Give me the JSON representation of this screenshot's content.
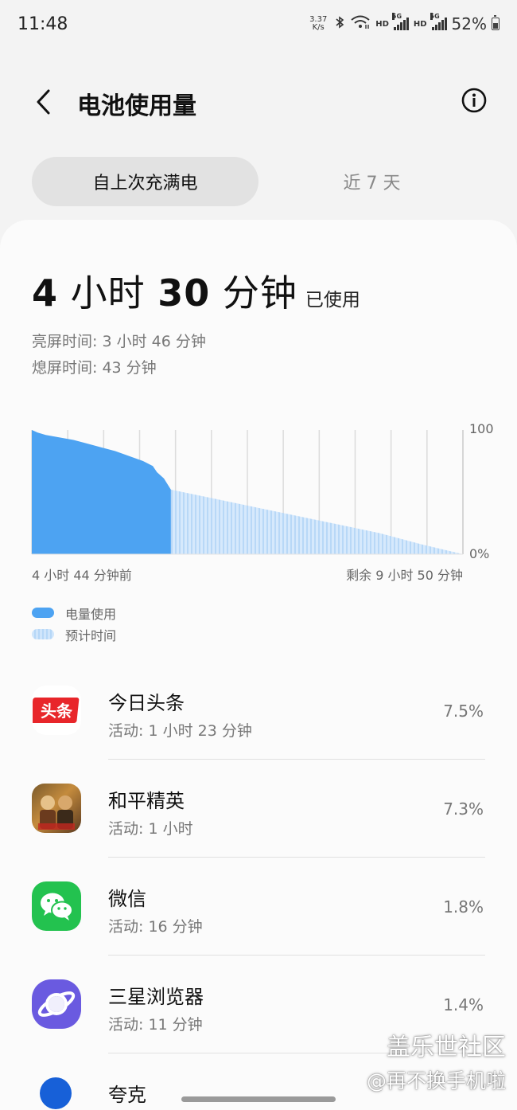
{
  "status_bar": {
    "time": "11:48",
    "net_speed_value": "3.37",
    "net_speed_unit": "K/s",
    "hd_1": "HD",
    "hd_2": "HD",
    "network_1": "5G",
    "network_2": "5G",
    "battery": "52%"
  },
  "header": {
    "title": "电池使用量"
  },
  "tabs": [
    {
      "label": "自上次充满电",
      "active": true
    },
    {
      "label": "近 7 天",
      "active": false
    }
  ],
  "summary": {
    "hours": "4",
    "hours_unit": "小时",
    "minutes": "30",
    "minutes_unit": "分钟",
    "suffix": "已使用",
    "screen_on": "亮屏时间: 3 小时 46 分钟",
    "screen_off": "熄屏时间: 43 分钟"
  },
  "chart_data": {
    "type": "area",
    "y_max_label": "100",
    "y_min_label": "0%",
    "ylim": [
      0,
      100
    ],
    "start_label": "4 小时 44 分钟前",
    "end_label": "剩余 9 小时 50 分钟",
    "series": [
      {
        "name": "电量使用",
        "x": [
          0,
          2,
          4,
          10,
          20,
          30,
          40,
          50,
          60,
          70,
          80,
          87,
          90,
          95,
          100
        ],
        "y": [
          100,
          99,
          98,
          96,
          94,
          92,
          89,
          86,
          83,
          79,
          75,
          71,
          66,
          61,
          52
        ]
      },
      {
        "name": "预计时间",
        "x": [
          100,
          130,
          160,
          190,
          220,
          250,
          280,
          310
        ],
        "y": [
          52,
          45,
          38,
          31,
          24,
          17,
          8,
          0
        ]
      }
    ],
    "legend": [
      "电量使用",
      "预计时间"
    ],
    "grid": true,
    "colors": {
      "used": "#4da3f2",
      "predicted": "#cfe5fb"
    }
  },
  "apps": [
    {
      "name": "今日头条",
      "activity": "活动: 1 小时 23 分钟",
      "percent": "7.5%",
      "icon": "toutiao-icon",
      "icon_text": "头条"
    },
    {
      "name": "和平精英",
      "activity": "活动: 1 小时",
      "percent": "7.3%",
      "icon": "game-icon"
    },
    {
      "name": "微信",
      "activity": "活动: 16 分钟",
      "percent": "1.8%",
      "icon": "wechat-icon"
    },
    {
      "name": "三星浏览器",
      "activity": "活动: 11 分钟",
      "percent": "1.4%",
      "icon": "browser-icon"
    },
    {
      "name": "夸克",
      "activity": "",
      "percent": "",
      "icon": "quark-icon"
    }
  ],
  "watermark": {
    "line1": "盖乐世社区",
    "line2": "@再不换手机啦"
  }
}
